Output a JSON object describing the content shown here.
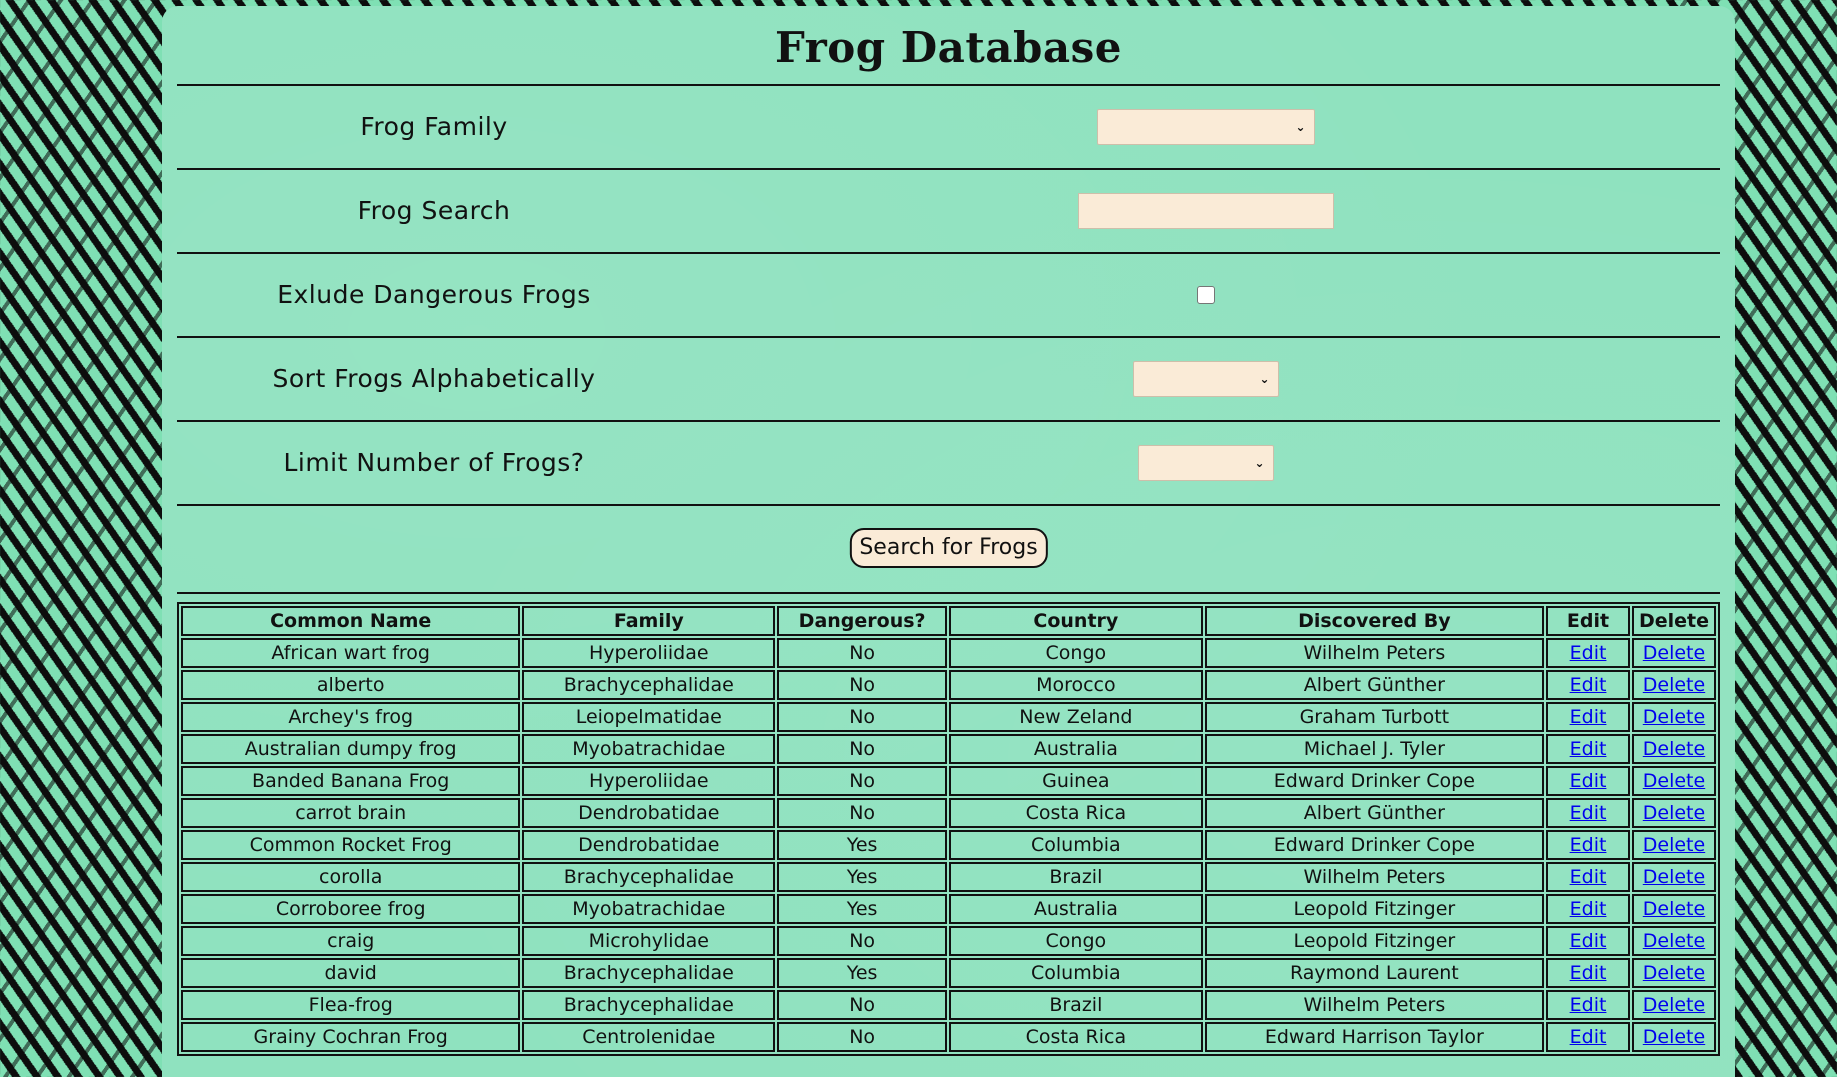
{
  "title": "Frog Database",
  "filters": {
    "family_label": "Frog Family",
    "family_value": "",
    "search_label": "Frog Search",
    "search_value": "",
    "exclude_label": "Exlude Dangerous Frogs",
    "exclude_checked": false,
    "sort_label": "Sort Frogs Alphabetically",
    "sort_value": "",
    "limit_label": "Limit Number of Frogs?",
    "limit_value": ""
  },
  "search_button": "Search for Frogs",
  "table": {
    "headers": [
      "Common Name",
      "Family",
      "Dangerous?",
      "Country",
      "Discovered By",
      "Edit",
      "Delete"
    ],
    "rows": [
      [
        "African wart frog",
        "Hyperoliidae",
        "No",
        "Congo",
        "Wilhelm Peters",
        "Edit",
        "Delete"
      ],
      [
        "alberto",
        "Brachycephalidae",
        "No",
        "Morocco",
        "Albert Günther",
        "Edit",
        "Delete"
      ],
      [
        "Archey's frog",
        "Leiopelmatidae",
        "No",
        "New Zeland",
        "Graham Turbott",
        "Edit",
        "Delete"
      ],
      [
        "Australian dumpy frog",
        "Myobatrachidae",
        "No",
        "Australia",
        "Michael J. Tyler",
        "Edit",
        "Delete"
      ],
      [
        "Banded Banana Frog",
        "Hyperoliidae",
        "No",
        "Guinea",
        "Edward Drinker Cope",
        "Edit",
        "Delete"
      ],
      [
        "carrot brain",
        "Dendrobatidae",
        "No",
        "Costa Rica",
        "Albert Günther",
        "Edit",
        "Delete"
      ],
      [
        "Common Rocket Frog",
        "Dendrobatidae",
        "Yes",
        "Columbia",
        "Edward Drinker Cope",
        "Edit",
        "Delete"
      ],
      [
        "corolla",
        "Brachycephalidae",
        "Yes",
        "Brazil",
        "Wilhelm Peters",
        "Edit",
        "Delete"
      ],
      [
        "Corroboree frog",
        "Myobatrachidae",
        "Yes",
        "Australia",
        "Leopold Fitzinger",
        "Edit",
        "Delete"
      ],
      [
        "craig",
        "Microhylidae",
        "No",
        "Congo",
        "Leopold Fitzinger",
        "Edit",
        "Delete"
      ],
      [
        "david",
        "Brachycephalidae",
        "Yes",
        "Columbia",
        "Raymond Laurent",
        "Edit",
        "Delete"
      ],
      [
        "Flea-frog",
        "Brachycephalidae",
        "No",
        "Brazil",
        "Wilhelm Peters",
        "Edit",
        "Delete"
      ],
      [
        "Grainy Cochran Frog",
        "Centrolenidae",
        "No",
        "Costa Rica",
        "Edward Harrison Taylor",
        "Edit",
        "Delete"
      ]
    ]
  }
}
